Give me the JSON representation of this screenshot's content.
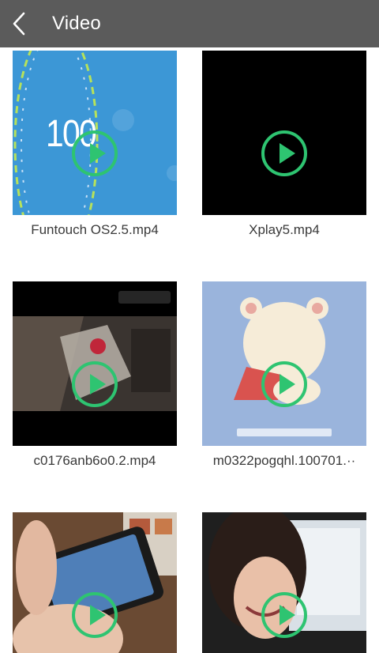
{
  "header": {
    "title": "Video",
    "back_icon": "chevron-left-icon"
  },
  "colors": {
    "topbar": "#5b5b5b",
    "play_accent": "#2ec471"
  },
  "videos": [
    {
      "filename": "Funtouch OS2.5.mp4",
      "thumb_text": "100"
    },
    {
      "filename": "Xplay5.mp4"
    },
    {
      "filename": "c0176anb6o0.2.mp4"
    },
    {
      "filename": "m0322pogqhl.100701.··"
    },
    {
      "filename": ""
    },
    {
      "filename": ""
    }
  ]
}
